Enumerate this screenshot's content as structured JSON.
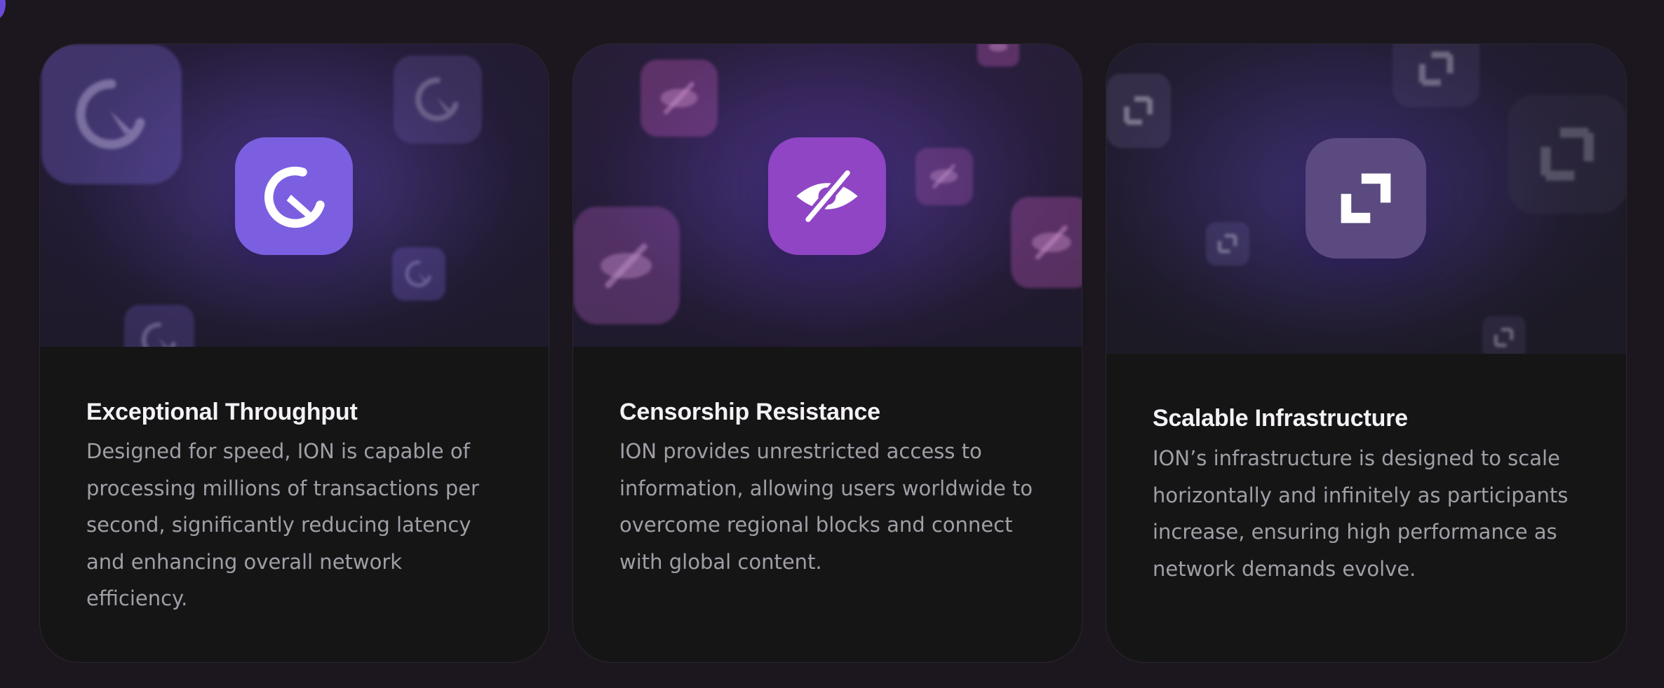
{
  "cards": [
    {
      "title": "Exceptional Throughput",
      "description": "Designed for speed, ION is capable of processing millions of transactions per second, significantly reducing latency and enhancing overall network efficiency.",
      "icon": "speedometer-icon",
      "icon_color": "#7b5fe0"
    },
    {
      "title": "Censorship Resistance",
      "description": "ION provides unrestricted access to information, allowing users worldwide to overcome regional blocks and connect with global content.",
      "icon": "eye-off-icon",
      "icon_color": "#8f45c4"
    },
    {
      "title": "Scalable Infrastructure",
      "description": "ION’s infrastructure is designed to scale horizontally and infinitely as participants increase, ensuring high performance as network demands evolve.",
      "icon": "expand-icon",
      "icon_color": "#5a4a80"
    }
  ],
  "colors": {
    "background": "#1c161e",
    "card": "#161516",
    "title": "#f4f2f6",
    "body_text": "#a19ea6",
    "accent": "#6a4bd8"
  }
}
